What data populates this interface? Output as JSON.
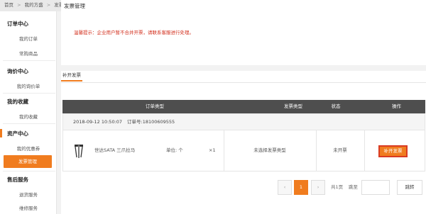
{
  "breadcrumb": {
    "home": "首页",
    "sep1": ">",
    "my_fang": "我的方盛",
    "sep2": ">",
    "current": "发票管理"
  },
  "sidebar": {
    "order_center": "订单中心",
    "my_orders": "我的订单",
    "frequent_products": "常购商品",
    "inquiry_center": "询价中心",
    "my_inquiries": "我的询价单",
    "my_favorites_title": "我的收藏",
    "my_favorites": "我的收藏",
    "asset_center": "资产中心",
    "my_coupons": "我的优惠券",
    "invoice_management": "发票管理",
    "after_sales": "售后服务",
    "returns": "退货服务",
    "repairs": "维修服务"
  },
  "main": {
    "title": "发票管理",
    "notice": "温馨提示：企业用户暂不合并开票，请联系客服进行处理。",
    "tab_label": "补开发票"
  },
  "table": {
    "headers": [
      "订单类型",
      "发票类型",
      "状态",
      "操作"
    ],
    "order_date": "2018-09-12 10:50:07",
    "order_number": "订单号:18100609555",
    "row": {
      "product_name": "世达SATA 三爪拉马",
      "unit": "单位: 个",
      "quantity": "×1",
      "invoice_type": "未选择发票类型",
      "status": "未开票",
      "action_label": "补开发票"
    }
  },
  "pagination": {
    "prev": "‹",
    "current_page": "1",
    "next": "›",
    "total_pages": "共1页",
    "goto_label": "跳至",
    "go_button": "跳转"
  },
  "colors": {
    "accent": "#f07c1f",
    "notice_red": "#d3311f",
    "table_header": "#4e4e4e"
  }
}
